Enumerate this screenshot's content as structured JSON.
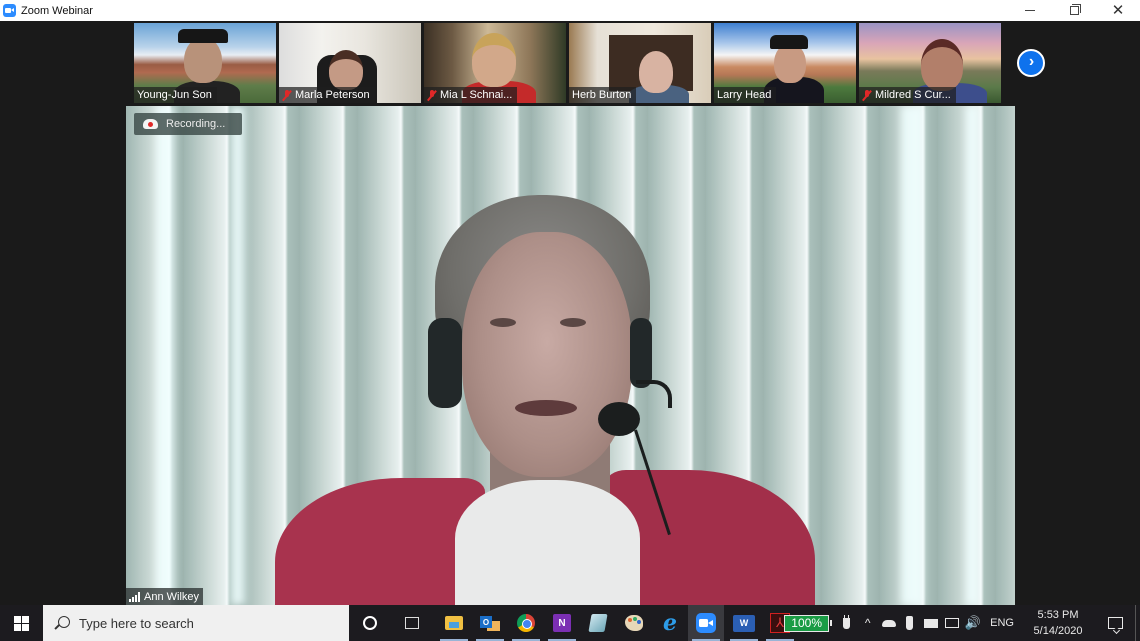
{
  "window": {
    "title": "Zoom Webinar",
    "controls": {
      "minimize": "minimize",
      "restore": "restore",
      "close": "close"
    }
  },
  "gallery": {
    "participants": [
      {
        "name": "Young-Jun Son",
        "muted": false,
        "scene": "campus"
      },
      {
        "name": "Marla Peterson",
        "muted": true,
        "scene": "room"
      },
      {
        "name": "Mia L Schnai...",
        "muted": true,
        "scene": "building"
      },
      {
        "name": "Herb Burton",
        "muted": false,
        "scene": "office"
      },
      {
        "name": "Larry Head",
        "muted": false,
        "scene": "sky"
      },
      {
        "name": "Mildred S Cur...",
        "muted": true,
        "scene": "sunset"
      }
    ],
    "next_page_icon": "chevron-right-icon"
  },
  "active_speaker": {
    "name": "Ann Wilkey",
    "recording_label": "Recording..."
  },
  "taskbar": {
    "search_placeholder": "Type here to search",
    "pinned_apps": [
      {
        "name": "cortana",
        "label": "Cortana"
      },
      {
        "name": "task-view",
        "label": "Task View"
      },
      {
        "name": "file-explorer",
        "label": "File Explorer"
      },
      {
        "name": "outlook",
        "label": "Outlook"
      },
      {
        "name": "chrome",
        "label": "Google Chrome"
      },
      {
        "name": "onenote",
        "label": "OneNote"
      },
      {
        "name": "notepad",
        "label": "Notepad"
      },
      {
        "name": "paint",
        "label": "Paint"
      },
      {
        "name": "internet-explorer",
        "label": "Internet Explorer"
      },
      {
        "name": "zoom",
        "label": "Zoom"
      },
      {
        "name": "word",
        "label": "Word"
      },
      {
        "name": "acrobat",
        "label": "Adobe Acrobat"
      }
    ],
    "onenote_glyph": "N",
    "outlook_glyph": "O",
    "word_glyph": "W",
    "ie_glyph": "e",
    "acrobat_glyph": "⅄",
    "tray": {
      "battery_percent": "100%",
      "show_hidden_glyph": "^",
      "volume_glyph": "🔊",
      "language": "ENG",
      "time": "5:53 PM",
      "date": "5/14/2020"
    }
  },
  "colors": {
    "zoom_blue": "#2d8cff",
    "next_button_blue": "#0e72ed",
    "muted_red": "#e02828",
    "battery_green": "#1a9c45",
    "taskbar_bg": "#1c1b1f"
  }
}
